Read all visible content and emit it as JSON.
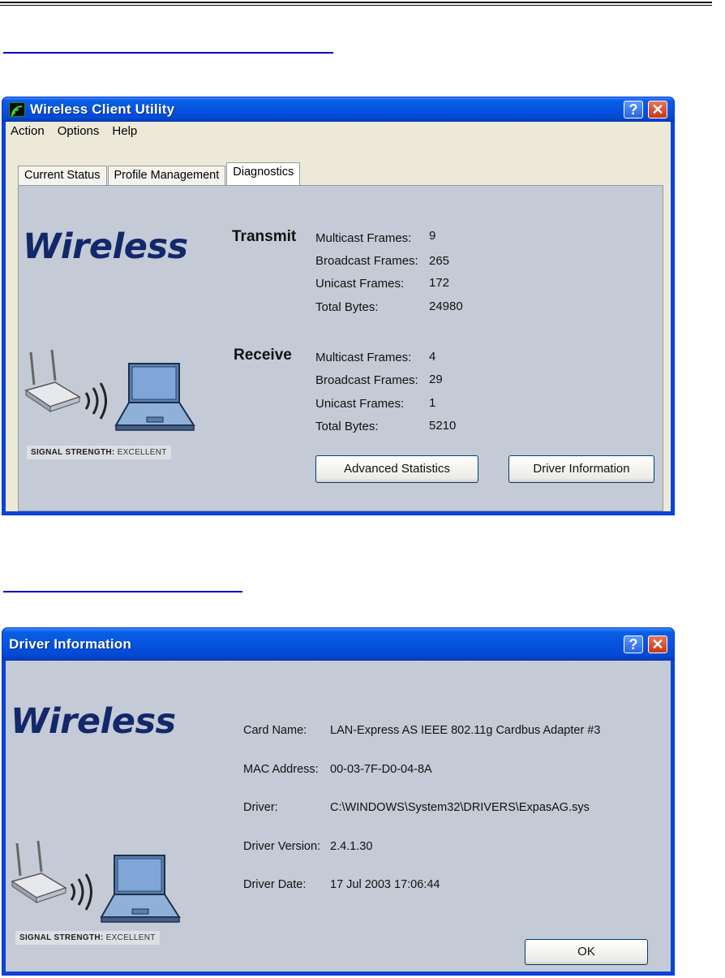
{
  "window1": {
    "title": "Wireless Client Utility",
    "menu": [
      "Action",
      "Options",
      "Help"
    ],
    "tabs": [
      "Current Status",
      "Profile Management",
      "Diagnostics"
    ],
    "active_tab": "Diagnostics",
    "logo_text": "Wireless",
    "signal": {
      "label": "SIGNAL STRENGTH:",
      "value": "EXCELLENT"
    },
    "transmit": {
      "title": "Transmit",
      "rows": [
        {
          "label": "Multicast Frames:",
          "value": "9"
        },
        {
          "label": "Broadcast Frames:",
          "value": "265"
        },
        {
          "label": "Unicast Frames:",
          "value": "172"
        },
        {
          "label": "Total Bytes:",
          "value": "24980"
        }
      ]
    },
    "receive": {
      "title": "Receive",
      "rows": [
        {
          "label": "Multicast Frames:",
          "value": "4"
        },
        {
          "label": "Broadcast Frames:",
          "value": "29"
        },
        {
          "label": "Unicast Frames:",
          "value": "1"
        },
        {
          "label": "Total Bytes:",
          "value": "5210"
        }
      ]
    },
    "buttons": {
      "advanced": "Advanced Statistics",
      "driver": "Driver Information"
    },
    "help_glyph": "?",
    "close_glyph": "✕"
  },
  "window2": {
    "title": "Driver Information",
    "logo_text": "Wireless",
    "signal": {
      "label": "SIGNAL STRENGTH:",
      "value": "EXCELLENT"
    },
    "fields": [
      {
        "label": "Card Name:",
        "value": "LAN-Express AS IEEE 802.11g Cardbus Adapter #3"
      },
      {
        "label": "MAC Address:",
        "value": "00-03-7F-D0-04-8A"
      },
      {
        "label": "Driver:",
        "value": "C:\\WINDOWS\\System32\\DRIVERS\\ExpasAG.sys"
      },
      {
        "label": "Driver Version:",
        "value": "2.4.1.30"
      },
      {
        "label": "Driver Date:",
        "value": "17 Jul 2003 17:06:44"
      }
    ],
    "ok_label": "OK",
    "help_glyph": "?",
    "close_glyph": "✕"
  },
  "colors": {
    "titlebar": "#0553e1",
    "panel": "#c4cbd6",
    "logo": "#13286b",
    "link_rule": "#0000c8"
  },
  "icons": [
    "wireless-app-icon",
    "help-icon",
    "close-icon",
    "access-point-icon",
    "signal-waves-icon",
    "laptop-icon"
  ]
}
